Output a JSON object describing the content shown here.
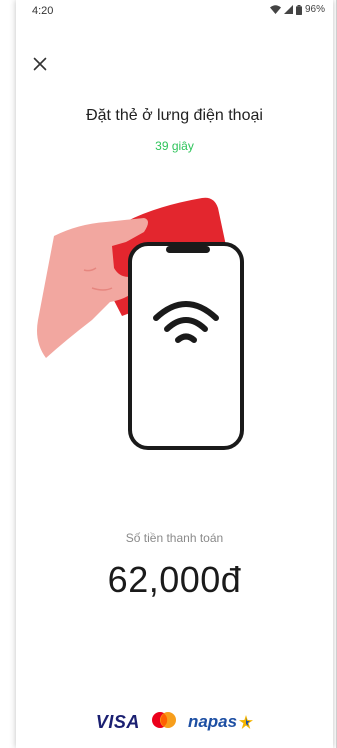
{
  "status_bar": {
    "time": "4:20",
    "battery": "96%",
    "icons": [
      "wifi-icon",
      "signal-icon",
      "battery-icon"
    ]
  },
  "header": {
    "close_icon": "close-icon"
  },
  "main": {
    "title": "Đặt thẻ ở lưng điện thoại",
    "timer": "39 giây",
    "illustration": "hand-card-phone-nfc-illustration"
  },
  "payment": {
    "label": "Số tiền thanh toán",
    "amount": "62,000đ"
  },
  "footer": {
    "visa_label": "VISA",
    "napas_label": "napas",
    "mastercard_icon": "mastercard-icon"
  },
  "colors": {
    "accent_green": "#2ec45a",
    "card_red": "#e3262e",
    "hand_pink": "#f2a7a0",
    "visa_blue": "#1a1f71",
    "napas_blue": "#1d4fa3",
    "mastercard_red": "#eb001b",
    "mastercard_orange": "#f79e1b"
  }
}
